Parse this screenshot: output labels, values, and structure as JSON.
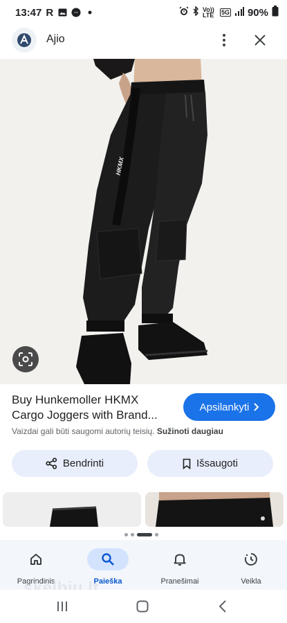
{
  "status_bar": {
    "time": "13:47",
    "carrier_letter": "R",
    "battery": "90%",
    "network_5g": "5G",
    "volte": "Vo)) LTE",
    "icons": [
      "image-icon",
      "messenger-icon",
      "notification-dot-icon",
      "alarm-icon",
      "bluetooth-icon",
      "signal-icon",
      "battery-icon"
    ]
  },
  "app_bar": {
    "title": "Ajio",
    "icons": [
      "ajio-logo-icon",
      "more-vertical-icon",
      "close-icon"
    ]
  },
  "product": {
    "title_line1": "Buy Hunkemoller HKMX",
    "title_line2": "Cargo Joggers with Brand...",
    "visit_label": "Apsilankyti",
    "copyright_text": "Vaizdai gali būti saugomi autorių teisių.",
    "learn_more": "Sužinoti daugiau",
    "tape_text": "HKMX"
  },
  "actions": {
    "share_label": "Bendrinti",
    "save_label": "Išsaugoti"
  },
  "bottom_nav": {
    "items": [
      {
        "label": "Pagrindinis",
        "icon": "home-icon",
        "active": false
      },
      {
        "label": "Paieška",
        "icon": "search-icon",
        "active": true
      },
      {
        "label": "Pranešimai",
        "icon": "bell-icon",
        "active": false
      },
      {
        "label": "Veikla",
        "icon": "activity-icon",
        "active": false
      }
    ]
  },
  "watermark": "skelbiu.lt",
  "colors": {
    "accent": "#1a73e8",
    "chip": "#e8eefb",
    "active_nav": "#d3e3fd"
  }
}
